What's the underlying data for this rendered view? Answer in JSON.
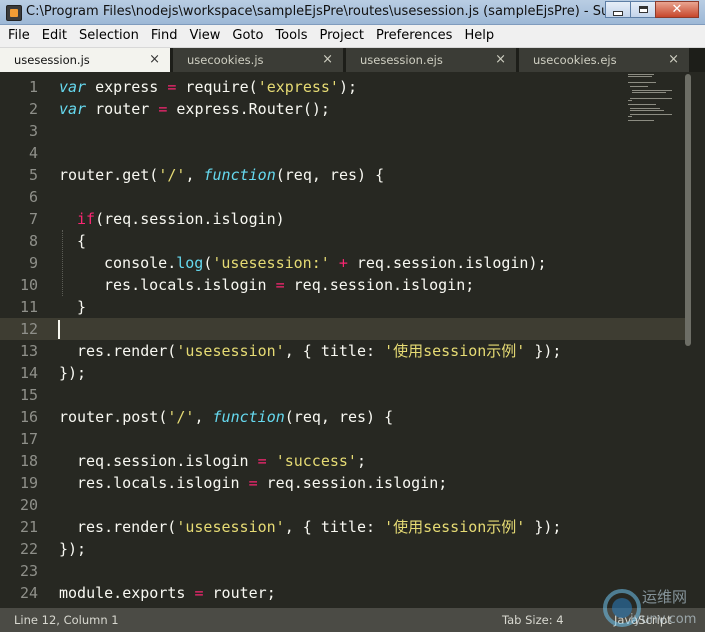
{
  "window": {
    "title": "C:\\Program Files\\nodejs\\workspace\\sampleEjsPre\\routes\\usesession.js (sampleEjsPre) - Sublime ..."
  },
  "menu": [
    "File",
    "Edit",
    "Selection",
    "Find",
    "View",
    "Goto",
    "Tools",
    "Project",
    "Preferences",
    "Help"
  ],
  "tabs": [
    {
      "label": "usesession.js",
      "active": true
    },
    {
      "label": "usecookies.js",
      "active": false
    },
    {
      "label": "usesession.ejs",
      "active": false
    },
    {
      "label": "usecookies.ejs",
      "active": false
    }
  ],
  "tab_close_glyph": "×",
  "line_numbers": [
    "1",
    "2",
    "3",
    "4",
    "5",
    "6",
    "7",
    "8",
    "9",
    "10",
    "11",
    "12",
    "13",
    "14",
    "15",
    "16",
    "17",
    "18",
    "19",
    "20",
    "21",
    "22",
    "23",
    "24"
  ],
  "code": {
    "l1": {
      "a": "var",
      "b": " express ",
      "c": "=",
      "d": " require(",
      "e": "'express'",
      "f": ");"
    },
    "l2": {
      "a": "var",
      "b": " router ",
      "c": "=",
      "d": " express.Router();"
    },
    "l5": {
      "a": "router.get(",
      "b": "'/'",
      "c": ", ",
      "d": "function",
      "e": "(req, res) {"
    },
    "l7": {
      "a": "if",
      "b": "(req.session.islogin)"
    },
    "l8": {
      "a": "{"
    },
    "l9": {
      "a": "console.",
      "b": "log",
      "c": "(",
      "d": "'usesession:'",
      "e": " ",
      "f": "+",
      "g": " req.session.islogin);"
    },
    "l10": {
      "a": "res.locals.islogin ",
      "b": "=",
      "c": " req.session.islogin;"
    },
    "l11": {
      "a": "}"
    },
    "l13": {
      "a": "res.render(",
      "b": "'usesession'",
      "c": ", { title: ",
      "d": "'使用session示例'",
      "e": " });"
    },
    "l14": {
      "a": "});"
    },
    "l16": {
      "a": "router.post(",
      "b": "'/'",
      "c": ", ",
      "d": "function",
      "e": "(req, res) {"
    },
    "l18": {
      "a": "req.session.islogin ",
      "b": "=",
      "c": " ",
      "d": "'success'",
      "e": ";"
    },
    "l19": {
      "a": "res.locals.islogin ",
      "b": "=",
      "c": " req.session.islogin;"
    },
    "l21": {
      "a": "res.render(",
      "b": "'usesession'",
      "c": ", { title: ",
      "d": "'使用session示例'",
      "e": " });"
    },
    "l22": {
      "a": "});"
    },
    "l24": {
      "a": "module.exports ",
      "b": "=",
      "c": " router;"
    }
  },
  "status": {
    "position": "Line 12, Column 1",
    "tab_size": "Tab Size: 4",
    "syntax": "JavaScript"
  },
  "watermark": {
    "cn": "运维网",
    "en": "iyunv.com"
  },
  "colors": {
    "background": "#272822",
    "keyword": "#66d9ef",
    "operator": "#f92672",
    "string": "#e6db74",
    "text": "#f8f8f2",
    "line_number": "#8f908a"
  }
}
